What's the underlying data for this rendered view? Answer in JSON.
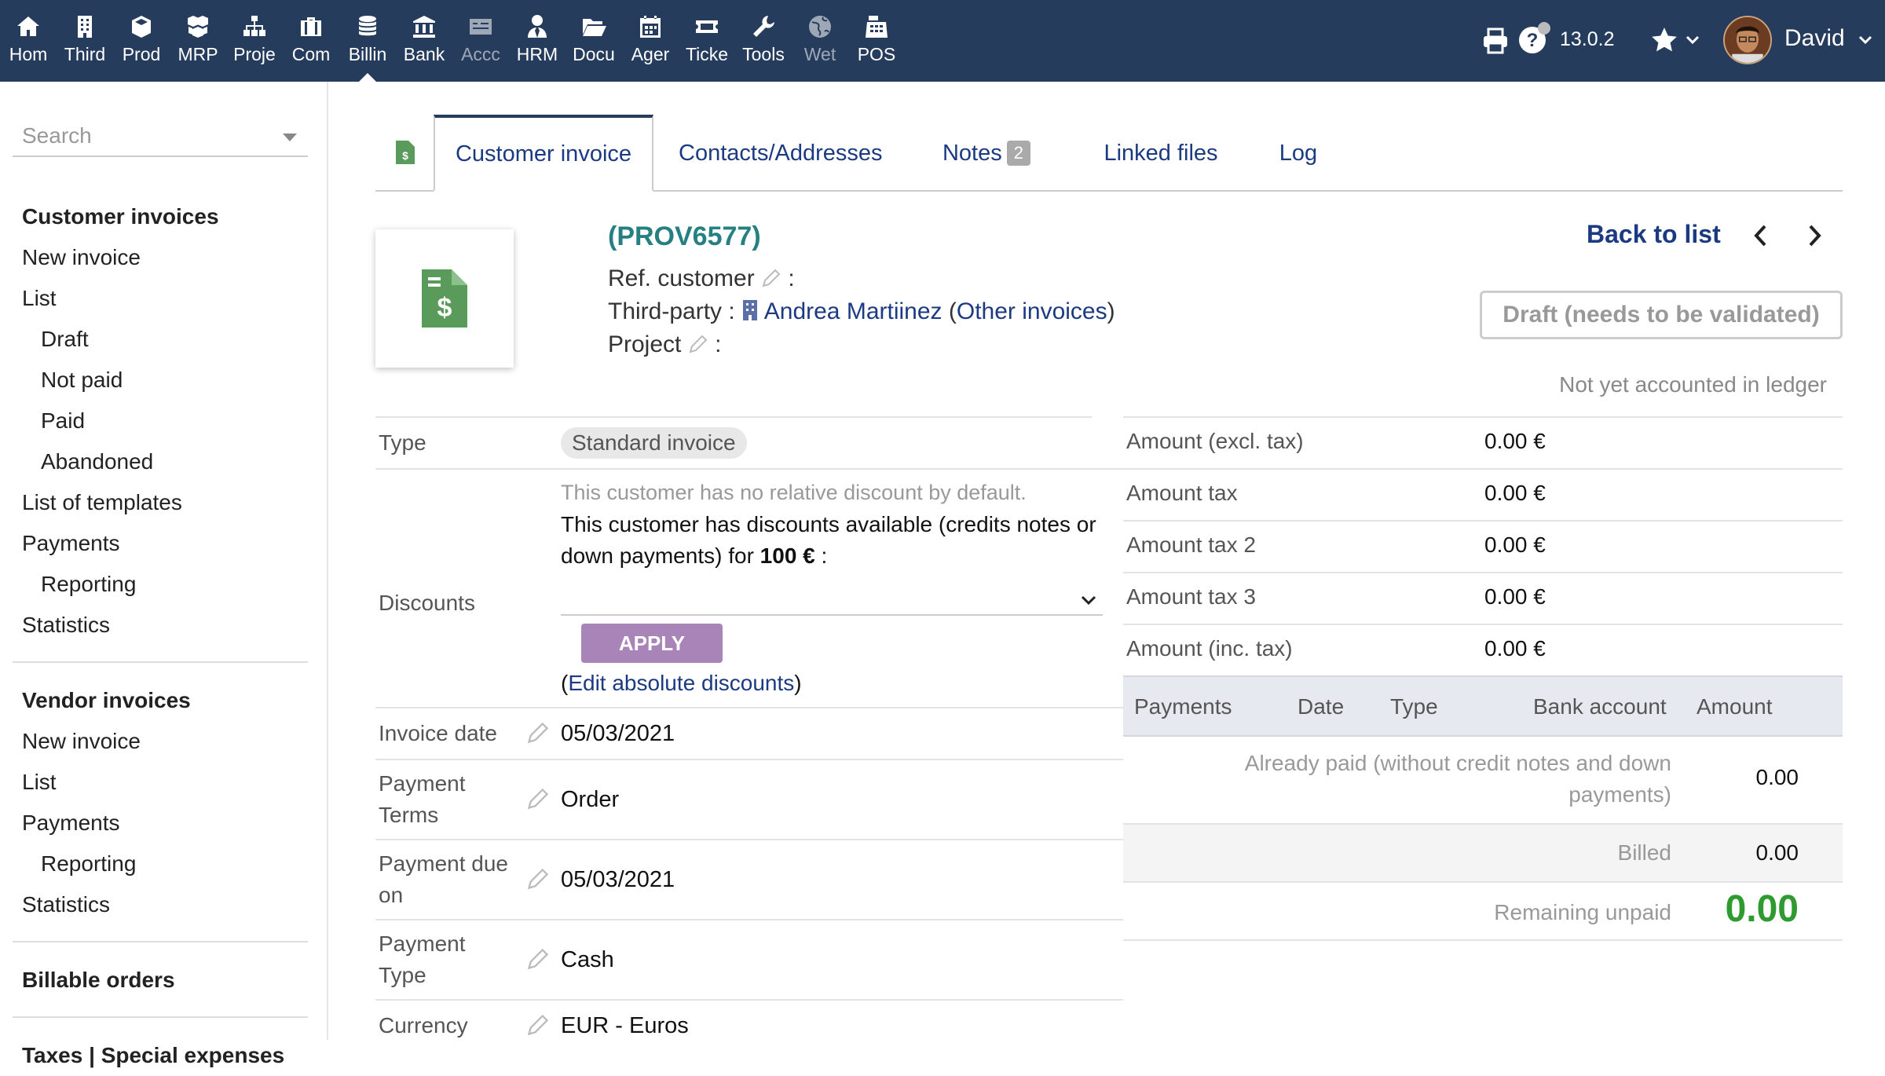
{
  "topbar": {
    "nav": [
      {
        "label": "Hom",
        "icon": "home-icon",
        "dim": false
      },
      {
        "label": "Third",
        "icon": "building-icon",
        "dim": false
      },
      {
        "label": "Prod",
        "icon": "cube-icon",
        "dim": false
      },
      {
        "label": "MRP",
        "icon": "cubes-icon",
        "dim": false
      },
      {
        "label": "Proje",
        "icon": "sitemap-icon",
        "dim": false
      },
      {
        "label": "Com",
        "icon": "briefcase-icon",
        "dim": false
      },
      {
        "label": "Billin",
        "icon": "coins-icon",
        "dim": false,
        "active": true
      },
      {
        "label": "Bank",
        "icon": "bank-icon",
        "dim": false
      },
      {
        "label": "Accc",
        "icon": "money-check-icon",
        "dim": true
      },
      {
        "label": "HRM",
        "icon": "user-tie-icon",
        "dim": false
      },
      {
        "label": "Docu",
        "icon": "folder-open-icon",
        "dim": false
      },
      {
        "label": "Ager",
        "icon": "calendar-icon",
        "dim": false
      },
      {
        "label": "Ticke",
        "icon": "ticket-icon",
        "dim": false
      },
      {
        "label": "Tools",
        "icon": "wrench-icon",
        "dim": false
      },
      {
        "label": "Wet",
        "icon": "globe-icon",
        "dim": true
      },
      {
        "label": "POS",
        "icon": "cash-register-icon",
        "dim": false
      }
    ],
    "version": "13.0.2",
    "username": "David"
  },
  "sidebar": {
    "search_placeholder": "Search",
    "sections": [
      {
        "title": "Customer invoices",
        "items": [
          {
            "label": "New invoice",
            "sub": false
          },
          {
            "label": "List",
            "sub": false
          },
          {
            "label": "Draft",
            "sub": true
          },
          {
            "label": "Not paid",
            "sub": true
          },
          {
            "label": "Paid",
            "sub": true
          },
          {
            "label": "Abandoned",
            "sub": true
          },
          {
            "label": "List of templates",
            "sub": false
          },
          {
            "label": "Payments",
            "sub": false
          },
          {
            "label": "Reporting",
            "sub": true
          },
          {
            "label": "Statistics",
            "sub": false
          }
        ]
      },
      {
        "title": "Vendor invoices",
        "items": [
          {
            "label": "New invoice",
            "sub": false
          },
          {
            "label": "List",
            "sub": false
          },
          {
            "label": "Payments",
            "sub": false
          },
          {
            "label": "Reporting",
            "sub": true
          },
          {
            "label": "Statistics",
            "sub": false
          }
        ]
      },
      {
        "title": "Billable orders",
        "items": []
      },
      {
        "title": "Taxes | Special expenses",
        "items": []
      }
    ]
  },
  "tabs": {
    "customer_invoice": "Customer invoice",
    "contacts": "Contacts/Addresses",
    "notes": "Notes",
    "notes_count": "2",
    "linked_files": "Linked files",
    "log": "Log"
  },
  "header": {
    "ref": "(PROV6577)",
    "ref_customer_label": "Ref. customer",
    "third_party_label": "Third-party :",
    "third_party_name": "Andrea Martiinez",
    "other_invoices": "Other invoices",
    "project_label": "Project",
    "colon": ":",
    "back_to_list": "Back to list",
    "status": "Draft (needs to be validated)",
    "ledger_note": "Not yet accounted in ledger"
  },
  "info": {
    "type_label": "Type",
    "type_value": "Standard invoice",
    "discounts_label": "Discounts",
    "discount_none": "This customer has no relative discount by default.",
    "discount_avail_pre": "This customer has discounts available (credits notes or down payments) for ",
    "discount_amount": "100 €",
    "discount_avail_post": " :",
    "apply_label": "APPLY",
    "edit_abs": "Edit absolute discounts",
    "invoice_date_label": "Invoice date",
    "invoice_date": "05/03/2021",
    "payment_terms_label_1": "Payment",
    "payment_terms_label_2": "Terms",
    "payment_terms": "Order",
    "due_label_1": "Payment due",
    "due_label_2": "on",
    "due_date": "05/03/2021",
    "ptype_label_1": "Payment",
    "ptype_label_2": "Type",
    "ptype": "Cash",
    "currency_label": "Currency",
    "currency": "EUR - Euros"
  },
  "amounts": {
    "rows": [
      {
        "label": "Amount (excl. tax)",
        "value": "0.00 €"
      },
      {
        "label": "Amount tax",
        "value": "0.00 €"
      },
      {
        "label": "Amount tax 2",
        "value": "0.00 €"
      },
      {
        "label": "Amount tax 3",
        "value": "0.00 €"
      },
      {
        "label": "Amount (inc. tax)",
        "value": "0.00 €"
      }
    ],
    "payments_head": {
      "payments": "Payments",
      "date": "Date",
      "type": "Type",
      "bank": "Bank account",
      "amount": "Amount"
    },
    "already_paid_1": "Already paid (without credit notes and down",
    "already_paid_2": "payments)",
    "already_paid_value": "0.00",
    "billed_label": "Billed",
    "billed_value": "0.00",
    "remaining_label": "Remaining unpaid",
    "remaining_value": "0.00"
  },
  "colors": {
    "topbar": "#263c5c",
    "link": "#1b3a82",
    "ref": "#268082",
    "apply": "#a984b8",
    "remaining": "#2f9a2f"
  }
}
